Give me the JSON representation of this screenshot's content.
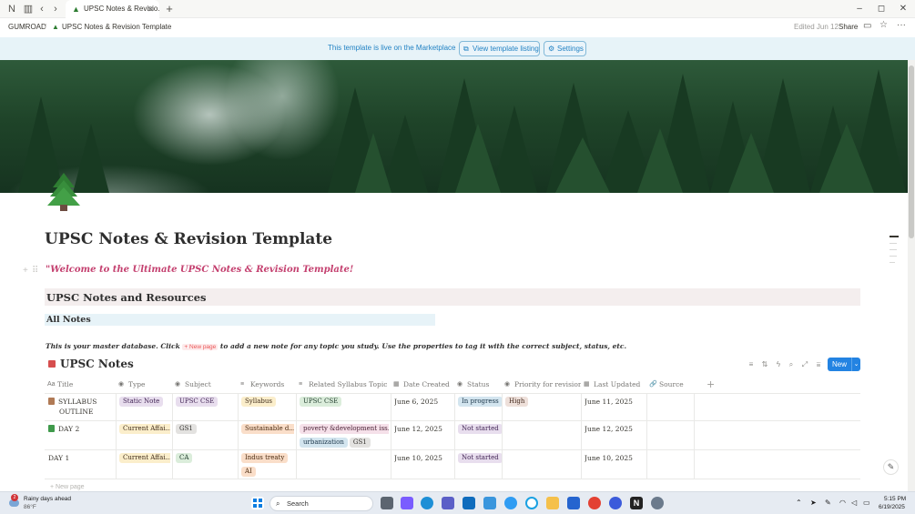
{
  "window": {
    "tab_title": "UPSC Notes & Revisio...",
    "new_tab": "+",
    "minimize": "–",
    "restore": "◻",
    "close": "✕"
  },
  "topbar": {
    "workspace": "GUMROAD",
    "page": "UPSC Notes & Revision Template",
    "edited": "Edited Jun 12",
    "share": "Share"
  },
  "banner": {
    "message": "This template is live on the Marketplace",
    "view_listing": "View template listing",
    "settings": "Settings"
  },
  "page": {
    "title": "UPSC Notes & Revision Template",
    "welcome": "\"Welcome to the Ultimate UPSC Notes & Revision Template!",
    "section_heading": "UPSC Notes and Resources",
    "subheading": "All Notes",
    "description_prefix": "This is your master database. Click",
    "description_new_page": "+ New page",
    "description_suffix": "to add a new note for any topic you study. Use the properties to tag it with the correct subject, status, etc."
  },
  "database": {
    "title": "UPSC Notes",
    "new_button": "New",
    "columns": [
      {
        "label": "Title",
        "icon": "Aa"
      },
      {
        "label": "Type",
        "icon": "◉"
      },
      {
        "label": "Subject",
        "icon": "◉"
      },
      {
        "label": "Keywords",
        "icon": "≡"
      },
      {
        "label": "Related Syllabus Topic",
        "icon": "≡"
      },
      {
        "label": "Date Created",
        "icon": "▦"
      },
      {
        "label": "Status",
        "icon": "◉"
      },
      {
        "label": "Priority for revision",
        "icon": "◉"
      },
      {
        "label": "Last Updated",
        "icon": "▦"
      },
      {
        "label": "Source",
        "icon": "🔗"
      }
    ],
    "add_column": "+",
    "rows": [
      {
        "title": "SYLLABUS OUTLINE",
        "title_line1": "SYLLABUS",
        "title_line2": "OUTLINE",
        "type": "Static Note",
        "subject": "UPSC CSE",
        "keywords": [
          "Syllabus"
        ],
        "syllabus_topics": [
          "UPSC CSE"
        ],
        "date_created": "June 6, 2025",
        "status": "In progress",
        "priority": "High",
        "last_updated": "June 11, 2025"
      },
      {
        "title": "DAY 2",
        "type": "Current Affai...",
        "subject": "GS1",
        "keywords": [
          "Sustainable d..."
        ],
        "syllabus_topics": [
          "poverty &development iss...",
          "urbanization",
          "GS1"
        ],
        "date_created": "June 12, 2025",
        "status": "Not started",
        "priority": "",
        "last_updated": "June 12, 2025"
      },
      {
        "title": "DAY 1",
        "type": "Current Affai...",
        "subject": "CA",
        "keywords": [
          "Indus treaty",
          "AI"
        ],
        "syllabus_topics": [],
        "date_created": "June 10, 2025",
        "status": "Not started",
        "priority": "",
        "last_updated": "June 10, 2025"
      }
    ],
    "new_page": "+ New page"
  },
  "taskbar": {
    "weather_title": "Rainy days ahead",
    "weather_temp": "86°F",
    "weather_badge": "2",
    "search": "Search",
    "time": "5:15 PM",
    "date": "6/19/2025"
  },
  "colors": {
    "accent": "#2383e2",
    "banner_bg": "#e7f3f8",
    "welcome_text": "#c4406f"
  }
}
